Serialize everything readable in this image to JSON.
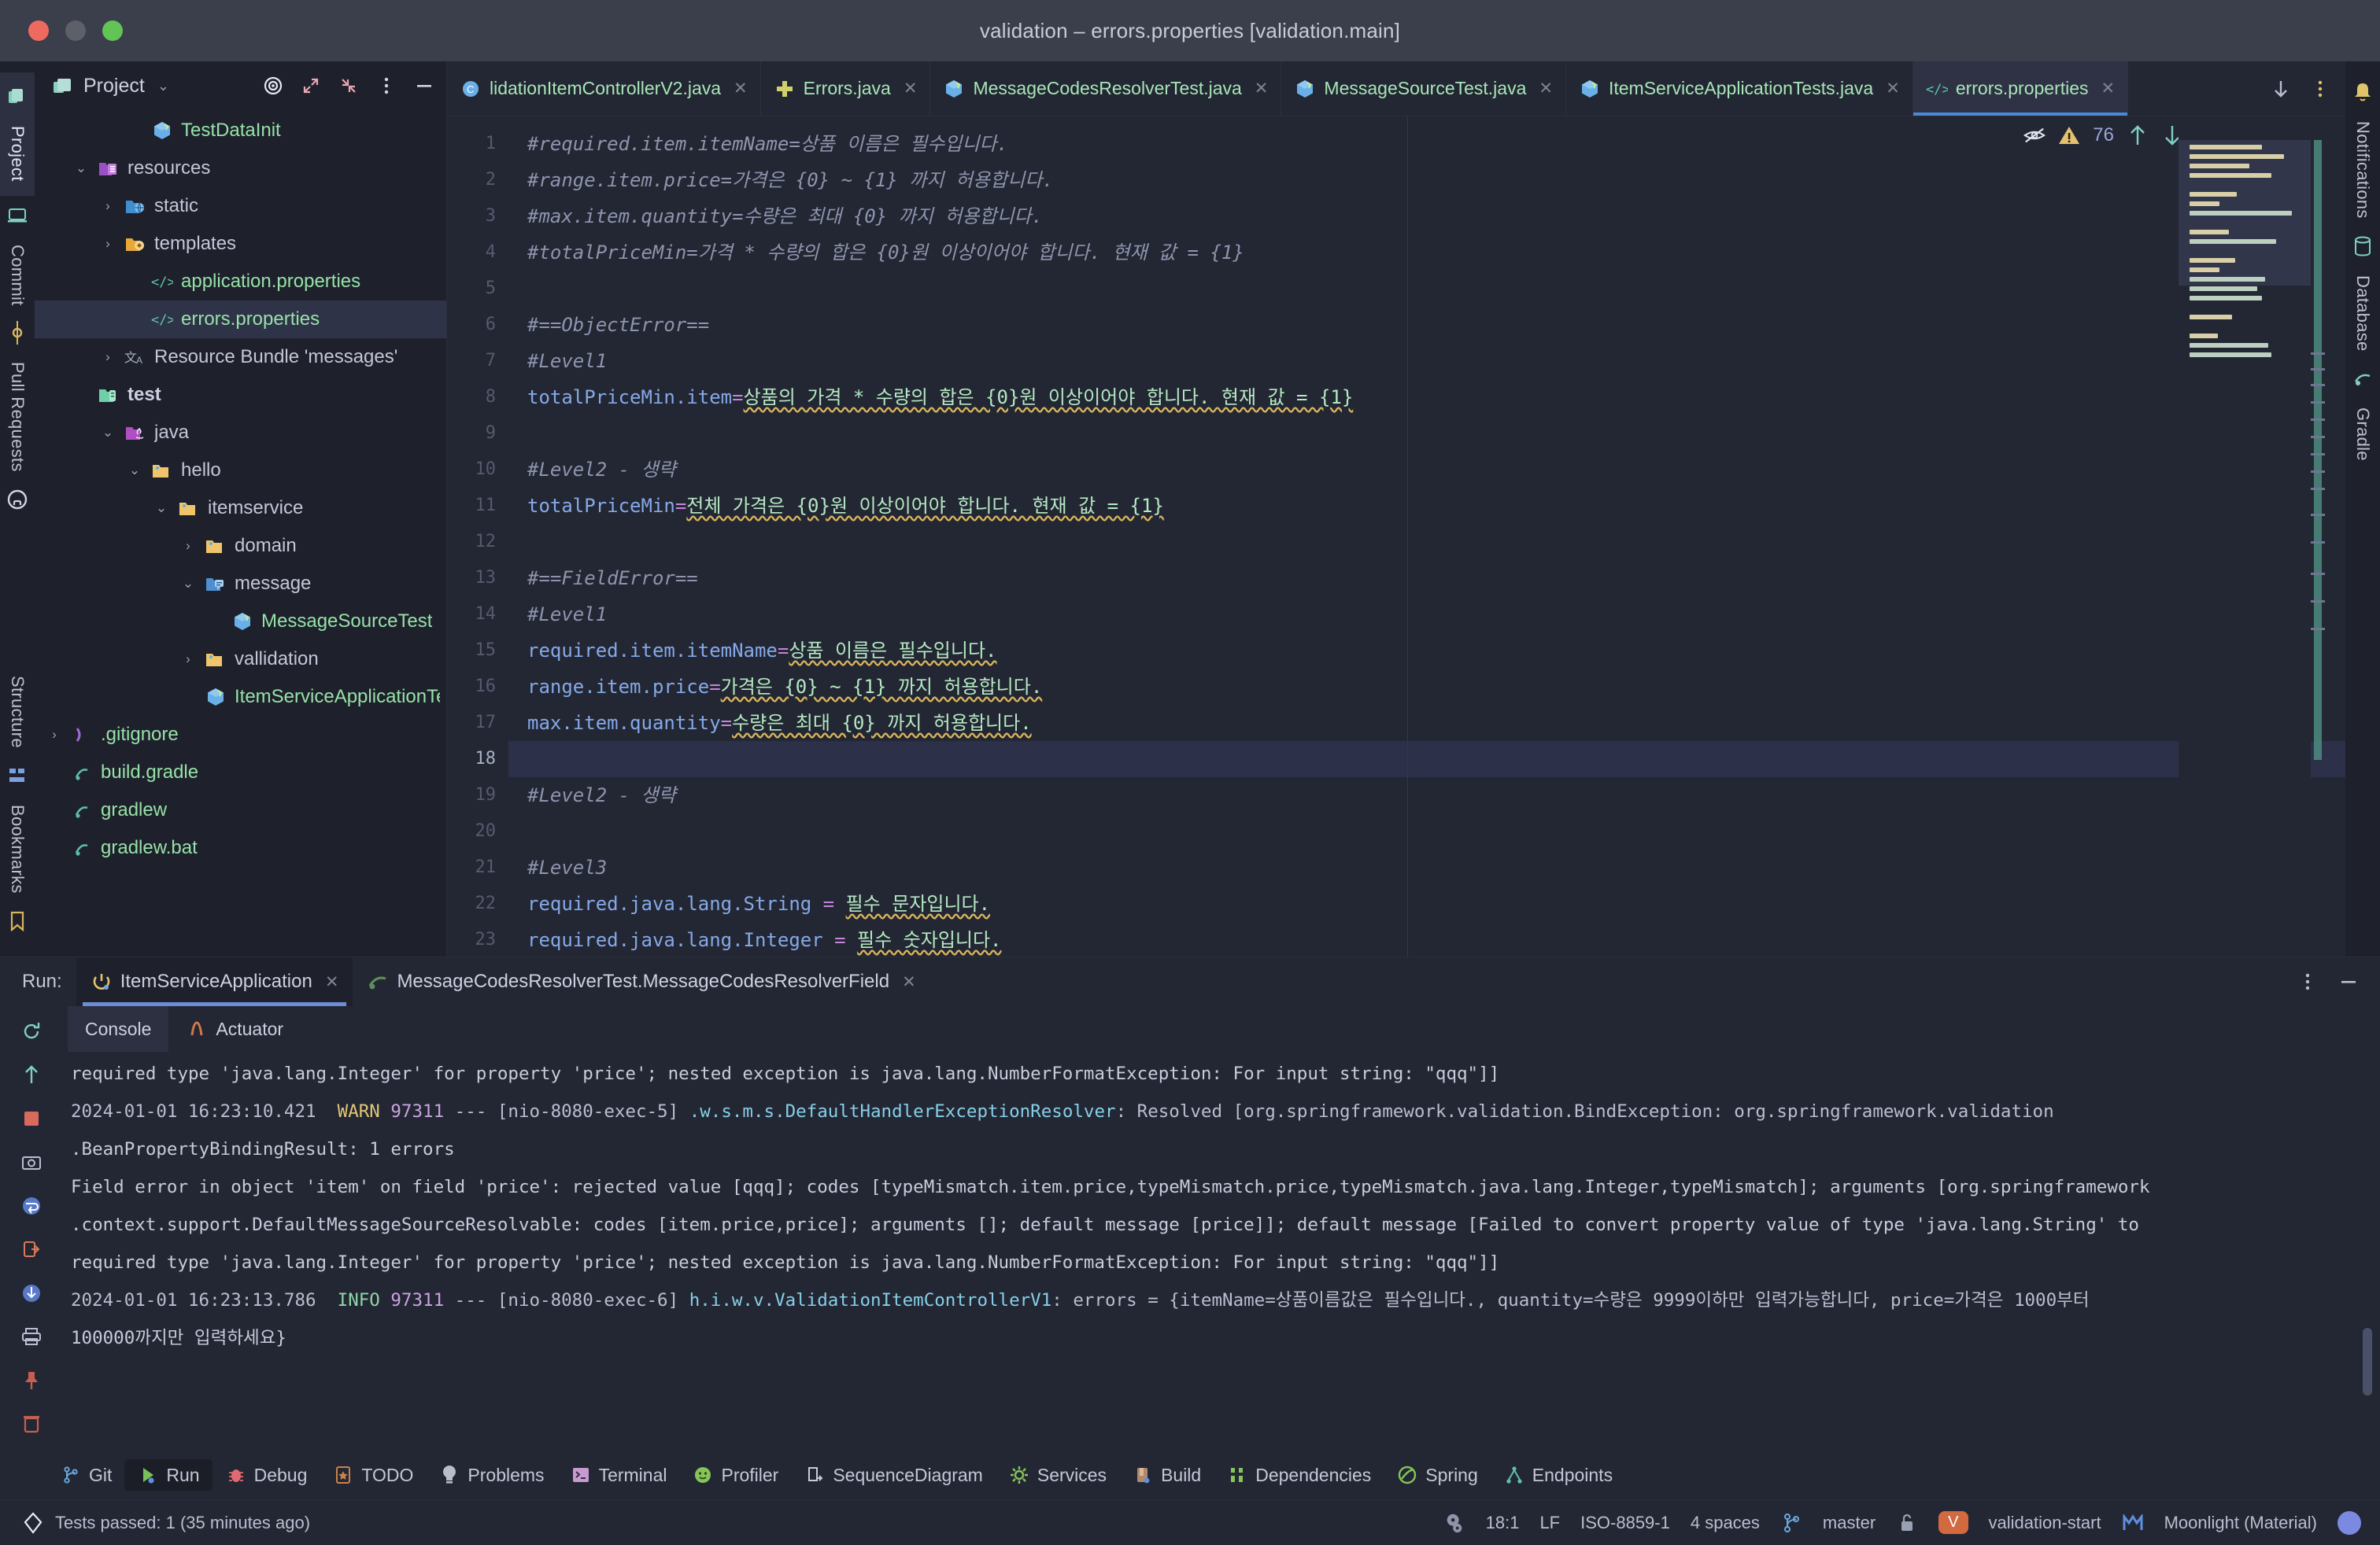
{
  "window": {
    "title": "validation – errors.properties [validation.main]",
    "traffic_lights": [
      "close",
      "minimize",
      "zoom"
    ]
  },
  "left_rail": {
    "top": [
      {
        "label": "Project",
        "icon": "project-icon",
        "selected": true
      },
      {
        "label": "",
        "icon": "commit-laptop-icon",
        "selected": false
      },
      {
        "label": "Commit",
        "icon": "commit-icon",
        "selected": false
      },
      {
        "label": "Pull Requests",
        "icon": "github-icon",
        "selected": false
      }
    ],
    "bottom": [
      {
        "label": "Structure",
        "icon": "structure-icon"
      },
      {
        "label": "Bookmarks",
        "icon": "bookmarks-icon"
      }
    ]
  },
  "right_rail": {
    "items": [
      {
        "label": "Notifications",
        "icon": "bell-icon"
      },
      {
        "label": "Database",
        "icon": "database-icon"
      },
      {
        "label": "Gradle",
        "icon": "gradle-icon"
      }
    ]
  },
  "project_panel": {
    "title": "Project",
    "chevron": "chevron-down-icon",
    "tools": [
      "target-icon",
      "expand-icon",
      "collapse-icon",
      "more-icon",
      "hide-icon"
    ],
    "tree": [
      {
        "indent": 3,
        "arrow": "",
        "icon": "class-icon",
        "label": "TestDataInit",
        "style": "green",
        "selected": false
      },
      {
        "indent": 1,
        "arrow": "v",
        "icon": "resources-folder-icon",
        "label": "resources",
        "style": "plain",
        "selected": false
      },
      {
        "indent": 2,
        "arrow": ">",
        "icon": "static-folder-icon",
        "label": "static",
        "style": "plain",
        "selected": false
      },
      {
        "indent": 2,
        "arrow": ">",
        "icon": "templates-folder-icon",
        "label": "templates",
        "style": "plain",
        "selected": false
      },
      {
        "indent": 3,
        "arrow": "",
        "icon": "properties-file-icon",
        "label": "application.properties",
        "style": "green",
        "selected": false
      },
      {
        "indent": 3,
        "arrow": "",
        "icon": "properties-file-icon",
        "label": "errors.properties",
        "style": "green",
        "selected": true
      },
      {
        "indent": 2,
        "arrow": ">",
        "icon": "resource-bundle-icon",
        "label": "Resource Bundle 'messages'",
        "style": "plain",
        "selected": false
      },
      {
        "indent": 1,
        "arrow": "",
        "icon": "test-folder-icon",
        "label": "test",
        "style": "bold",
        "selected": false
      },
      {
        "indent": 2,
        "arrow": "v",
        "icon": "java-folder-icon",
        "label": "java",
        "style": "plain",
        "selected": false
      },
      {
        "indent": 3,
        "arrow": "v",
        "icon": "package-icon",
        "label": "hello",
        "style": "plain",
        "selected": false
      },
      {
        "indent": 4,
        "arrow": "v",
        "icon": "package-icon",
        "label": "itemservice",
        "style": "plain",
        "selected": false
      },
      {
        "indent": 5,
        "arrow": ">",
        "icon": "package-icon",
        "label": "domain",
        "style": "plain",
        "selected": false
      },
      {
        "indent": 5,
        "arrow": "v",
        "icon": "message-folder-icon",
        "label": "message",
        "style": "plain",
        "selected": false
      },
      {
        "indent": 6,
        "arrow": "",
        "icon": "class-icon",
        "label": "MessageSourceTest",
        "style": "green",
        "selected": false
      },
      {
        "indent": 5,
        "arrow": ">",
        "icon": "package-icon",
        "label": "vallidation",
        "style": "plain",
        "selected": false
      },
      {
        "indent": 5,
        "arrow": "",
        "icon": "class-icon",
        "label": "ItemServiceApplicationTes",
        "style": "green",
        "selected": false
      },
      {
        "indent": 0,
        "arrow": ">",
        "icon": "gitignore-icon",
        "label": ".gitignore",
        "style": "green",
        "selected": false
      },
      {
        "indent": 0,
        "arrow": "",
        "icon": "gradle-file-icon",
        "label": "build.gradle",
        "style": "green",
        "selected": false
      },
      {
        "indent": 0,
        "arrow": "",
        "icon": "gradle-file-icon",
        "label": "gradlew",
        "style": "green",
        "selected": false
      },
      {
        "indent": 0,
        "arrow": "",
        "icon": "gradle-file-icon",
        "label": "gradlew.bat",
        "style": "green",
        "selected": false
      }
    ]
  },
  "editor": {
    "tabs": [
      {
        "label": "lidationItemControllerV2.java",
        "icon": "java-class-icon",
        "active": false,
        "closable": true
      },
      {
        "label": "Errors.java",
        "icon": "interface-icon",
        "active": false,
        "closable": true
      },
      {
        "label": "MessageCodesResolverTest.java",
        "icon": "test-class-icon",
        "active": false,
        "closable": true
      },
      {
        "label": "MessageSourceTest.java",
        "icon": "test-class-icon",
        "active": false,
        "closable": true
      },
      {
        "label": "ItemServiceApplicationTests.java",
        "icon": "test-class-icon",
        "active": false,
        "closable": true
      },
      {
        "label": "errors.properties",
        "icon": "properties-file-icon",
        "active": true,
        "closable": true
      }
    ],
    "tab_tools": [
      "scroll-down-icon",
      "more-icon"
    ],
    "inspection": {
      "eye_icon": "hide-inspections-icon",
      "warning_icon": "warning-triangle-icon",
      "warning_count": "76",
      "up_icon": "arrow-up-icon",
      "down_icon": "arrow-down-icon"
    },
    "caret_line": 18,
    "lines": [
      {
        "n": 1,
        "type": "comment",
        "text": "#required.item.itemName=상품 이름은 필수입니다."
      },
      {
        "n": 2,
        "type": "comment",
        "text": "#range.item.price=가격은 {0} ~ {1} 까지 허용합니다."
      },
      {
        "n": 3,
        "type": "comment",
        "text": "#max.item.quantity=수량은 최대 {0} 까지 허용합니다."
      },
      {
        "n": 4,
        "type": "comment",
        "text": "#totalPriceMin=가격 * 수량의 합은 {0}원 이상이어야 합니다. 현재 값 = {1}"
      },
      {
        "n": 5,
        "type": "blank",
        "text": ""
      },
      {
        "n": 6,
        "type": "comment",
        "text": "#==ObjectError=="
      },
      {
        "n": 7,
        "type": "comment",
        "text": "#Level1"
      },
      {
        "n": 8,
        "type": "prop",
        "key": "totalPriceMin.item",
        "sep": "=",
        "value": "상품의 가격 * 수량의 합은 {0}원 이상이어야 합니다. 현재 값 = {1}"
      },
      {
        "n": 9,
        "type": "blank",
        "text": ""
      },
      {
        "n": 10,
        "type": "comment",
        "text": "#Level2 - 생략"
      },
      {
        "n": 11,
        "type": "prop",
        "key": "totalPriceMin",
        "sep": "=",
        "value": "전체 가격은 {0}원 이상이어야 합니다. 현재 값 = {1}"
      },
      {
        "n": 12,
        "type": "blank",
        "text": ""
      },
      {
        "n": 13,
        "type": "comment",
        "text": "#==FieldError=="
      },
      {
        "n": 14,
        "type": "comment",
        "text": "#Level1"
      },
      {
        "n": 15,
        "type": "prop",
        "key": "required.item.itemName",
        "sep": "=",
        "value": "상품 이름은 필수입니다."
      },
      {
        "n": 16,
        "type": "prop",
        "key": "range.item.price",
        "sep": "=",
        "value": "가격은 {0} ~ {1} 까지 허용합니다."
      },
      {
        "n": 17,
        "type": "prop",
        "key": "max.item.quantity",
        "sep": "=",
        "value": "수량은 최대 {0} 까지 허용합니다."
      },
      {
        "n": 18,
        "type": "blank",
        "text": ""
      },
      {
        "n": 19,
        "type": "comment",
        "text": "#Level2 - 생략"
      },
      {
        "n": 20,
        "type": "blank",
        "text": ""
      },
      {
        "n": 21,
        "type": "comment",
        "text": "#Level3"
      },
      {
        "n": 22,
        "type": "prop",
        "key": "required.java.lang.String",
        "sep": " = ",
        "value": "필수 문자입니다."
      },
      {
        "n": 23,
        "type": "prop",
        "key": "required.java.lang.Integer",
        "sep": " = ",
        "value": "필수 숫자입니다."
      }
    ]
  },
  "run_panel": {
    "run_label": "Run:",
    "tabs": [
      {
        "label": "ItemServiceApplication",
        "icon": "spring-run-icon",
        "active": true,
        "closable": true
      },
      {
        "label": "MessageCodesResolverTest.MessageCodesResolverField",
        "icon": "gradle-run-icon",
        "active": false,
        "closable": true
      }
    ],
    "tools": [
      "more-icon",
      "minimize-icon"
    ],
    "side_buttons": [
      "rerun-icon",
      "stop-icon",
      "camera-icon",
      "export-icon",
      "soft-wrap-icon",
      "scroll-end-icon",
      "print-icon",
      "pin-icon",
      "trash-icon"
    ],
    "up_down": [
      "arrow-up-icon"
    ],
    "sub_tabs": [
      {
        "label": "Console",
        "icon": "",
        "active": true
      },
      {
        "label": "Actuator",
        "icon": "actuator-icon",
        "active": false
      }
    ],
    "console_lines": [
      {
        "type": "plain",
        "text": "required type 'java.lang.Integer' for property 'price'; nested exception is java.lang.NumberFormatException: For input string: \"qqq\"]]"
      },
      {
        "type": "log",
        "ts": "2024-01-01 16:23:10.421",
        "level": "WARN",
        "pid": "97311",
        "sep": "---",
        "thread": "[nio-8080-exec-5]",
        "logger": ".w.s.m.s.DefaultHandlerExceptionResolver",
        "msg": ": Resolved [org.springframework.validation.BindException: org.springframework.validation"
      },
      {
        "type": "plain",
        "text": ".BeanPropertyBindingResult: 1 errors"
      },
      {
        "type": "plain",
        "text": "Field error in object 'item' on field 'price': rejected value [qqq]; codes [typeMismatch.item.price,typeMismatch.price,typeMismatch.java.lang.Integer,typeMismatch]; arguments [org.springframework"
      },
      {
        "type": "plain",
        "text": ".context.support.DefaultMessageSourceResolvable: codes [item.price,price]; arguments []; default message [price]]; default message [Failed to convert property value of type 'java.lang.String' to"
      },
      {
        "type": "plain",
        "text": "required type 'java.lang.Integer' for property 'price'; nested exception is java.lang.NumberFormatException: For input string: \"qqq\"]]"
      },
      {
        "type": "log",
        "ts": "2024-01-01 16:23:13.786",
        "level": "INFO",
        "pid": "97311",
        "sep": "---",
        "thread": "[nio-8080-exec-6]",
        "logger": "h.i.w.v.ValidationItemControllerV1",
        "msg": ": errors = {itemName=상품이름값은 필수입니다., quantity=수량은 9999이하만 입력가능합니다, price=가격은 1000부터"
      },
      {
        "type": "plain",
        "text": "100000까지만 입력하세요}"
      }
    ]
  },
  "bottom_strip": {
    "items": [
      {
        "label": "Git",
        "icon": "git-icon",
        "active": false
      },
      {
        "label": "Run",
        "icon": "run-icon",
        "active": true
      },
      {
        "label": "Debug",
        "icon": "debug-icon",
        "active": false
      },
      {
        "label": "TODO",
        "icon": "todo-icon",
        "active": false
      },
      {
        "label": "Problems",
        "icon": "problems-icon",
        "active": false
      },
      {
        "label": "Terminal",
        "icon": "terminal-icon",
        "active": false
      },
      {
        "label": "Profiler",
        "icon": "profiler-icon",
        "active": false
      },
      {
        "label": "SequenceDiagram",
        "icon": "sequence-diagram-icon",
        "active": false
      },
      {
        "label": "Services",
        "icon": "services-icon",
        "active": false
      },
      {
        "label": "Build",
        "icon": "build-icon",
        "active": false
      },
      {
        "label": "Dependencies",
        "icon": "dependencies-icon",
        "active": false
      },
      {
        "label": "Spring",
        "icon": "spring-icon",
        "active": false
      },
      {
        "label": "Endpoints",
        "icon": "endpoints-icon",
        "active": false
      }
    ]
  },
  "status_bar": {
    "left_icon": "tests-passed-icon",
    "left_text": "Tests passed: 1 (35 minutes ago)",
    "right": {
      "inspection_icon": "inspection-widget-icon",
      "caret_position": "18:1",
      "line_separator": "LF",
      "encoding": "ISO-8859-1",
      "indent": "4 spaces",
      "branch_icon": "branch-icon",
      "branch": "master",
      "lock_icon": "unlocked-icon",
      "badge_letter": "V",
      "project_name": "validation-start",
      "theme_icon": "material-theme-icon",
      "theme": "Moonlight (Material)",
      "avatar": "user-avatar"
    }
  },
  "colors": {
    "bg": "#232733",
    "panel": "#1e212b",
    "accent_blue": "#4a88d8",
    "green_text": "#97e1a8",
    "comment": "#8e94ae",
    "key_blue": "#85a9e8",
    "value_green": "#b5e8c3",
    "warn": "#e0c674",
    "badge_orange": "#d2693f"
  }
}
